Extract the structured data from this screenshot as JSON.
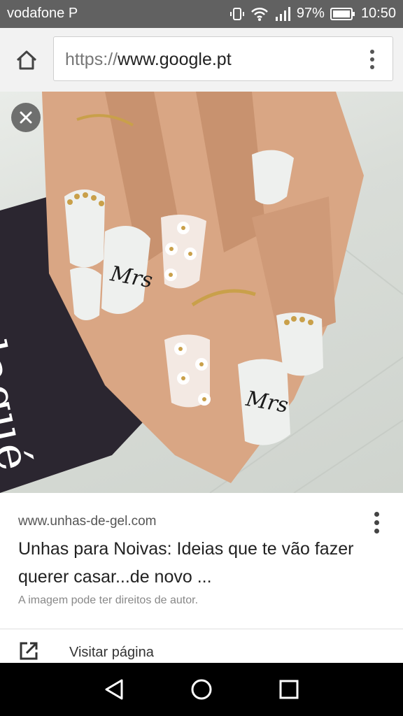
{
  "status_bar": {
    "carrier": "vodafone P",
    "battery": "97%",
    "time": "10:50"
  },
  "browser": {
    "url_scheme": "https://",
    "url_host": "www.google.pt"
  },
  "image": {
    "card_text": "laqué"
  },
  "result": {
    "domain": "www.unhas-de-gel.com",
    "title": "Unhas para Noivas: Ideias que te vão fazer querer casar...de novo ...",
    "copyright": "A imagem pode ter direitos de autor."
  },
  "visit": {
    "label": "Visitar página"
  },
  "nail_text": {
    "mrs_1": "Mrs",
    "mrs_2": "Mrs"
  },
  "colors": {
    "status_bar": "#616161",
    "nav_bar": "#000000",
    "card": "#2b2630",
    "skin": "#d9a684",
    "nail": "#eef0ee",
    "gold": "#c9a04a"
  }
}
